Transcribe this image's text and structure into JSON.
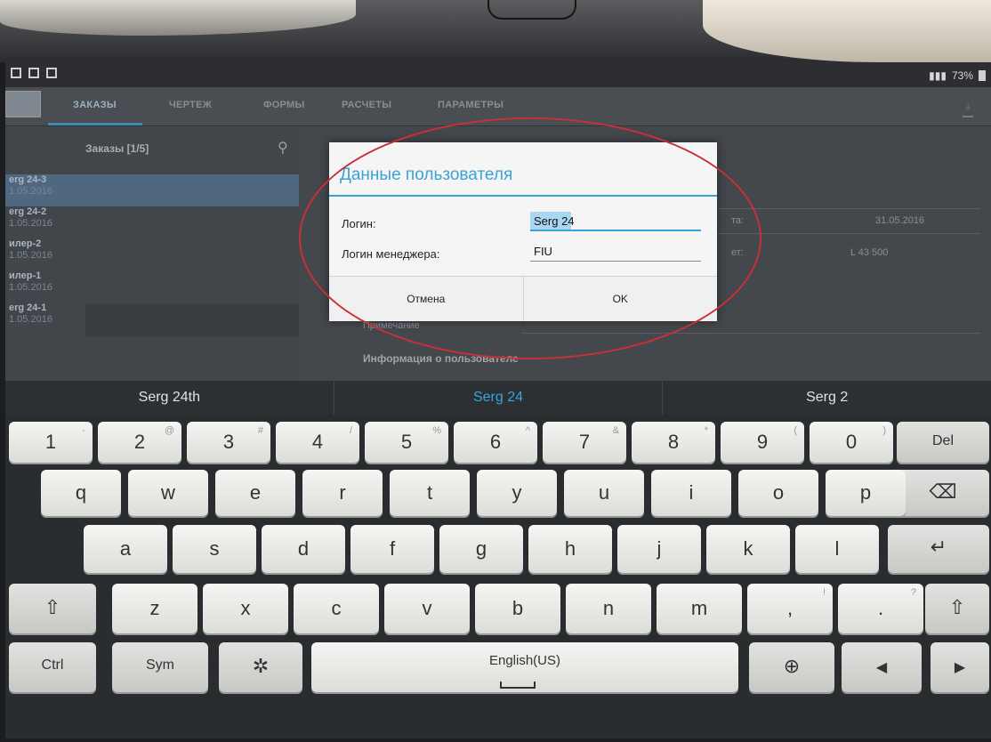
{
  "app": {
    "tabs": [
      {
        "label": "ЗАКАЗЫ",
        "active": true
      },
      {
        "label": "ЧЕРТЕЖ",
        "active": false
      },
      {
        "label": "ФОРМЫ",
        "active": false
      },
      {
        "label": "РАСЧЕТЫ",
        "active": false
      },
      {
        "label": "ПАРАМЕТРЫ",
        "active": false
      }
    ]
  },
  "status": {
    "battery": "73%"
  },
  "orders": {
    "title": "Заказы [1/5]",
    "items": [
      {
        "name": "erg 24-3",
        "date": "1.05.2016",
        "selected": true
      },
      {
        "name": "erg 24-2",
        "date": "1.05.2016"
      },
      {
        "name": "илер-2",
        "date": "1.05.2016"
      },
      {
        "name": "илер-1",
        "date": "1.05.2016"
      },
      {
        "name": "erg 24-1",
        "date": "1.05.2016"
      }
    ]
  },
  "detail": {
    "label1": "та:",
    "value1": "31.05.2016",
    "label2": "ет:",
    "value2": "L 43 500",
    "label3": "Примечание",
    "heading": "Информация о пользователе"
  },
  "dialog": {
    "title": "Данные пользователя",
    "login_label": "Логин:",
    "login_value": "Serg 24",
    "manager_label": "Логин менеджера:",
    "manager_value": "FIU",
    "cancel_label": "Отмена",
    "ok_label": "OK"
  },
  "keyboard": {
    "suggestions": [
      "Serg 24th",
      "Serg 24",
      "Serg 2"
    ],
    "row1": [
      {
        "k": "1",
        "h": "-"
      },
      {
        "k": "2",
        "h": "@"
      },
      {
        "k": "3",
        "h": "#"
      },
      {
        "k": "4",
        "h": "/"
      },
      {
        "k": "5",
        "h": "%"
      },
      {
        "k": "6",
        "h": "^"
      },
      {
        "k": "7",
        "h": "&"
      },
      {
        "k": "8",
        "h": "*"
      },
      {
        "k": "9",
        "h": "("
      },
      {
        "k": "0",
        "h": ")"
      }
    ],
    "del": "Del",
    "row2": [
      "q",
      "w",
      "e",
      "r",
      "t",
      "y",
      "u",
      "i",
      "o",
      "p"
    ],
    "row3": [
      "a",
      "s",
      "d",
      "f",
      "g",
      "h",
      "j",
      "k",
      "l"
    ],
    "row4": [
      "z",
      "x",
      "c",
      "v",
      "b",
      "n",
      "m",
      ",",
      "."
    ],
    "row4_hints": [
      "",
      "",
      "",
      "",
      "",
      "",
      "",
      "!",
      "?"
    ],
    "ctrl": "Ctrl",
    "sym": "Sym",
    "language": "English(US)",
    "icons": {
      "shift": "⇧",
      "backspace": "⌫",
      "enter": "↵",
      "settings": "✲",
      "globe": "⊕",
      "left": "◀",
      "right": "▶",
      "search": "⚲",
      "download": "⤓"
    }
  },
  "colors": {
    "accent": "#3aa3d6",
    "annotation": "#c6303a"
  }
}
